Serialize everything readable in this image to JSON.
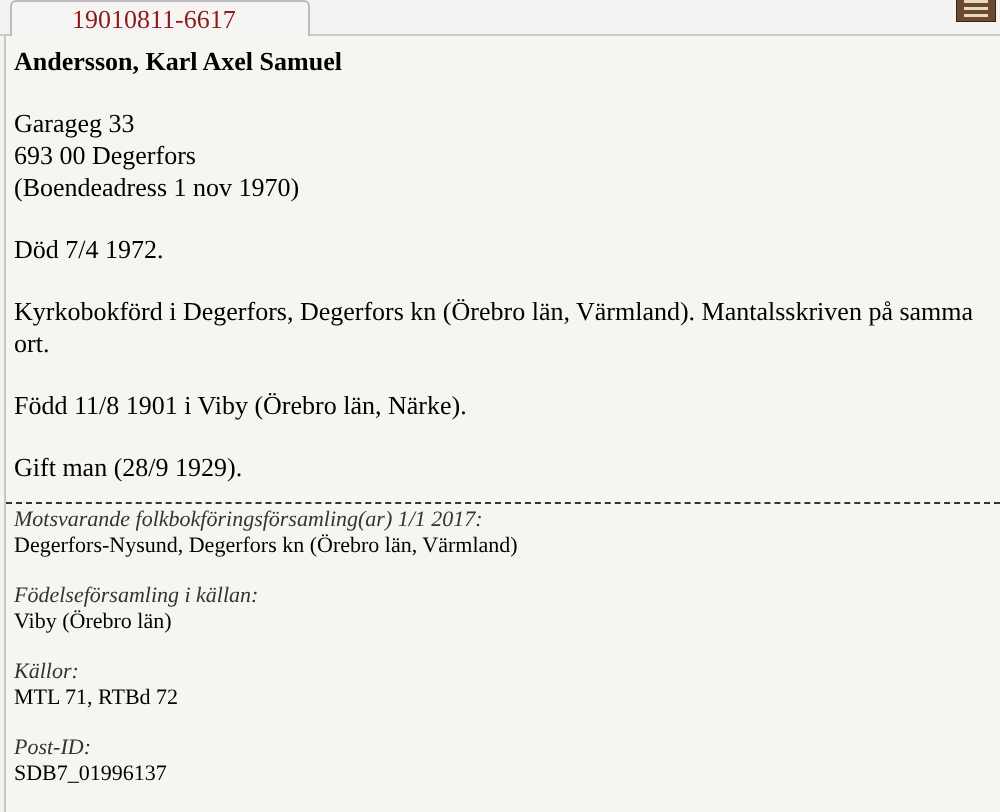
{
  "tabs": [
    {
      "label": "19010811-6617",
      "selected": true
    }
  ],
  "person": {
    "name": "Andersson, Karl Axel Samuel",
    "blocks": [
      [
        "Garageg 33",
        "693 00 Degerfors",
        "(Boendeadress 1 nov 1970)"
      ],
      [
        "Död 7/4 1972."
      ],
      [
        "Kyrkobokförd i Degerfors, Degerfors kn (Örebro län, Värmland). Mantalsskriven på samma ort."
      ],
      [
        "Född 11/8 1901 i Viby (Örebro län, Närke)."
      ],
      [
        "Gift man (28/9 1929)."
      ]
    ]
  },
  "details": [
    {
      "label": "Motsvarande folkbokföringsförsamling(ar) 1/1 2017:",
      "value": "Degerfors-Nysund, Degerfors kn (Örebro län, Värmland)"
    },
    {
      "label": "Födelseförsamling i källan:",
      "value": "Viby (Örebro län)"
    },
    {
      "label": "Källor:",
      "value": "MTL 71, RTBd 72"
    },
    {
      "label": "Post-ID:",
      "value": "SDB7_01996137"
    }
  ]
}
